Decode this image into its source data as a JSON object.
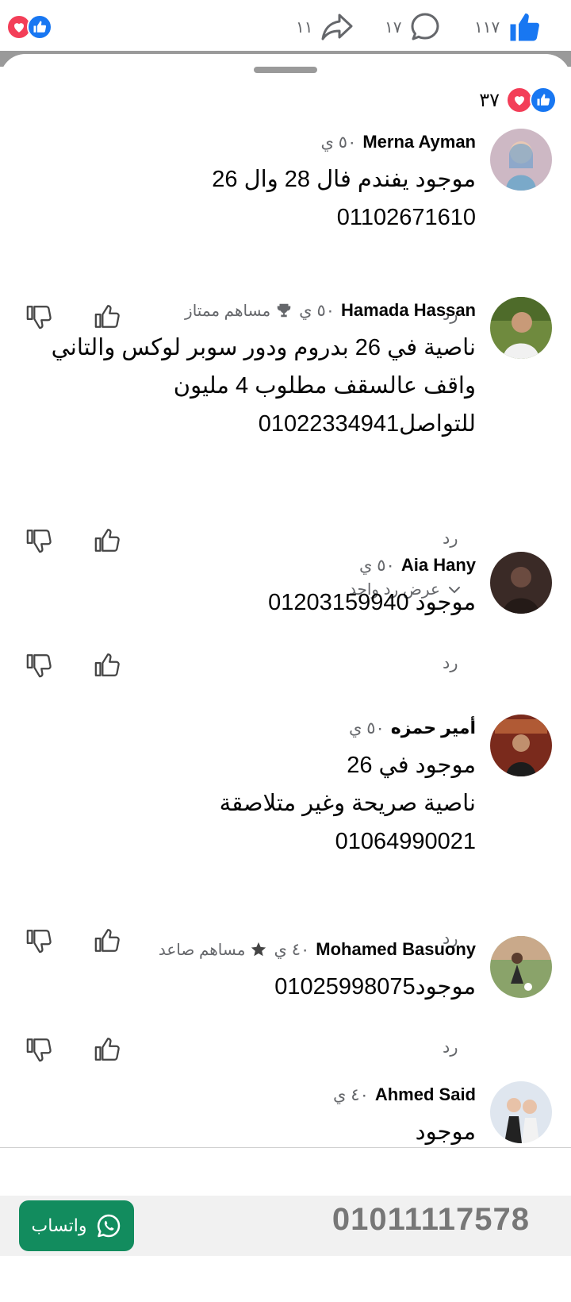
{
  "top_bar": {
    "like_count": "١١٧",
    "comment_count": "١٧",
    "share_count": "١١"
  },
  "sheet": {
    "reaction_count": "٣٧"
  },
  "comments": [
    {
      "name": "Merna Ayman",
      "time": "٥٠ ي",
      "badge": "",
      "lines": [
        "موجود يفندم فال 28 وال 26",
        "01102671610"
      ],
      "reply": "رد"
    },
    {
      "name": "Hamada Hassan",
      "time": "٥٠ ي",
      "badge": "مساهم ممتاز",
      "lines": [
        "ناصية في 26 بدروم ودور سوبر لوكس والتاني",
        "واقف عالسقف مطلوب 4 مليون",
        "للتواصل01022334941"
      ],
      "reply": "رد",
      "view_replies": "عرض رد واحد"
    },
    {
      "name": "Aia Hany",
      "time": "٥٠ ي",
      "badge": "",
      "lines": [
        "موجود 01203159940"
      ],
      "reply": "رد"
    },
    {
      "name": "أمير حمزه",
      "time": "٥٠ ي",
      "badge": "",
      "lines": [
        "موجود في 26",
        "ناصية صريحة وغير متلاصقة",
        "01064990021"
      ],
      "reply": "رد"
    },
    {
      "name": "Mohamed Basuony",
      "time": "٤٠ ي",
      "badge": "مساهم صاعد",
      "lines": [
        "موجود01025998075"
      ],
      "reply": "رد"
    },
    {
      "name": "Ahmed Said",
      "time": "٤٠ ي",
      "badge": "",
      "lines": [
        "موجود"
      ],
      "reply": ""
    }
  ],
  "bottom_bar": {
    "whatsapp_label": "واتساب",
    "phone_number": "01011117578"
  },
  "colors": {
    "like_blue": "#1877f2",
    "love_red": "#f33e58",
    "whatsapp_green": "#128c5e",
    "secondary_text": "#65676b"
  }
}
